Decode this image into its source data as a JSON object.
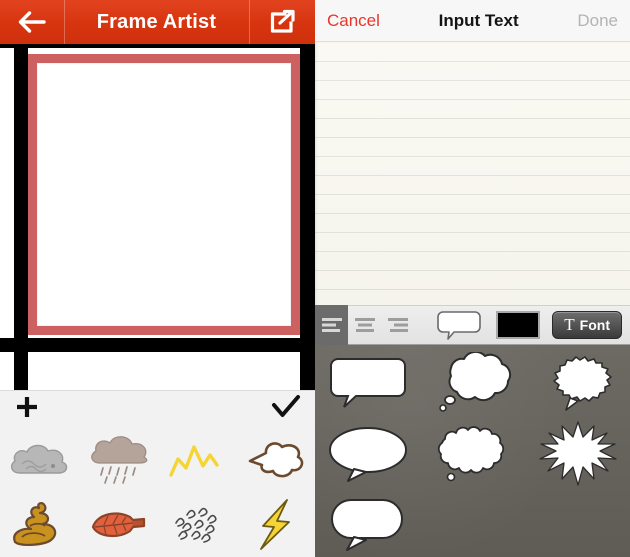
{
  "left": {
    "nav": {
      "back_icon": "arrow-left-icon",
      "title": "Frame Artist",
      "share_icon": "share-icon",
      "bg_color": "#d6340f"
    },
    "canvas": {
      "frame_color": "#cd6161",
      "grid_color": "#000000",
      "photo_placeholder": ""
    },
    "sticker_bar": {
      "add_label": "+",
      "confirm_label": "✓",
      "bg_color": "#f2f2f2",
      "stickers": [
        {
          "name": "cloud-sticker",
          "label": "Cloud"
        },
        {
          "name": "rain-cloud-sticker",
          "label": "Rain Cloud"
        },
        {
          "name": "zigzag-sticker",
          "label": "Zigzag"
        },
        {
          "name": "puff-sticker",
          "label": "Puff"
        },
        {
          "name": "swirl-sticker",
          "label": "Swirl"
        },
        {
          "name": "leaf-sticker",
          "label": "Leaf"
        },
        {
          "name": "sleet-sticker",
          "label": "Sleet"
        },
        {
          "name": "lightning-sticker",
          "label": "Lightning"
        }
      ]
    }
  },
  "right": {
    "nav": {
      "cancel_label": "Cancel",
      "title": "Input Text",
      "done_label": "Done",
      "cancel_color": "#e8372b",
      "done_color": "#b4b4b4"
    },
    "editor": {
      "text_value": "",
      "placeholder": ""
    },
    "toolbar": {
      "align_options": [
        {
          "name": "align-left-icon",
          "label": "Align Left",
          "selected": true
        },
        {
          "name": "align-center-icon",
          "label": "Align Center",
          "selected": false
        },
        {
          "name": "align-right-icon",
          "label": "Align Right",
          "selected": false
        }
      ],
      "bubble_swatch": "speech-bubble-icon",
      "color_swatch_value": "#000000",
      "font_label": "Font",
      "font_icon": "text-T-icon"
    },
    "bubbles": {
      "bg_color": "#65625c",
      "items": [
        {
          "name": "bubble-rounded-rect",
          "label": "Rounded Rectangle Bubble"
        },
        {
          "name": "bubble-thought",
          "label": "Thought Cloud Bubble"
        },
        {
          "name": "bubble-spiky-oval",
          "label": "Spiky Oval Bubble"
        },
        {
          "name": "bubble-ellipse",
          "label": "Ellipse Bubble"
        },
        {
          "name": "bubble-scalloped",
          "label": "Scalloped Cloud Bubble"
        },
        {
          "name": "bubble-starburst",
          "label": "Starburst Bubble"
        },
        {
          "name": "bubble-pill",
          "label": "Pill Bubble"
        }
      ]
    }
  }
}
